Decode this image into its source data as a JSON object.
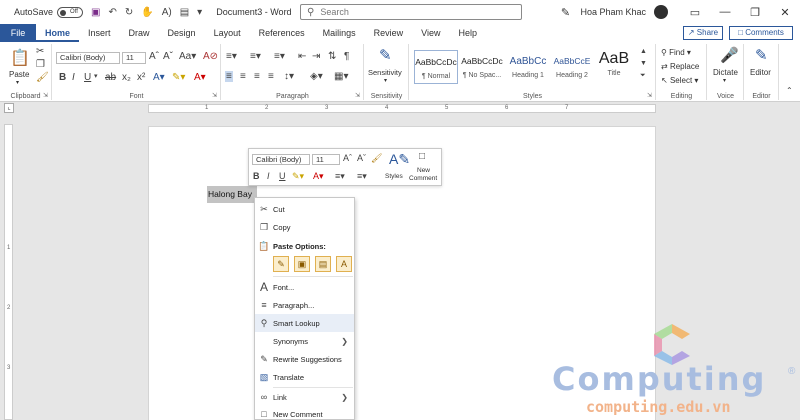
{
  "titlebar": {
    "autosave_label": "AutoSave",
    "autosave_state": "Off",
    "doc_title": "Document3 - Word",
    "search_placeholder": "Search",
    "user_name": "Hoa Pham Khac"
  },
  "tabs": [
    "File",
    "Home",
    "Insert",
    "Draw",
    "Design",
    "Layout",
    "References",
    "Mailings",
    "Review",
    "View",
    "Help"
  ],
  "active_tab": "Home",
  "share_label": "Share",
  "comments_label": "Comments",
  "ribbon": {
    "clipboard": {
      "paste_label": "Paste",
      "group_label": "Clipboard"
    },
    "font": {
      "font_name": "Calibri (Body)",
      "font_size": "11",
      "group_label": "Font"
    },
    "paragraph": {
      "group_label": "Paragraph"
    },
    "sensitivity": {
      "label": "Sensitivity",
      "group_label": "Sensitivity"
    },
    "styles": {
      "group_label": "Styles",
      "items": [
        {
          "sample": "AaBbCcDc",
          "name": "¶ Normal"
        },
        {
          "sample": "AaBbCcDc",
          "name": "¶ No Spac..."
        },
        {
          "sample": "AaBbCc",
          "name": "Heading 1"
        },
        {
          "sample": "AaBbCcE",
          "name": "Heading 2"
        },
        {
          "sample": "AaB",
          "name": "Title"
        }
      ]
    },
    "editing": {
      "find": "Find",
      "replace": "Replace",
      "select": "Select",
      "group_label": "Editing"
    },
    "voice": {
      "dictate": "Dictate",
      "group_label": "Voice"
    },
    "editor": {
      "label": "Editor",
      "group_label": "Editor"
    }
  },
  "ruler": {
    "marks": [
      "1",
      "2",
      "3",
      "4",
      "5",
      "6",
      "7"
    ],
    "vmarks": [
      "1",
      "2",
      "3"
    ]
  },
  "document": {
    "selected_text": "Halong Bay"
  },
  "mini_toolbar": {
    "font_name": "Calibri (Body)",
    "font_size": "11",
    "styles_label": "Styles",
    "new_comment_label1": "New",
    "new_comment_label2": "Comment"
  },
  "context_menu": {
    "cut": "Cut",
    "copy": "Copy",
    "paste_options": "Paste Options:",
    "font": "Font...",
    "paragraph": "Paragraph...",
    "smart_lookup": "Smart Lookup",
    "synonyms": "Synonyms",
    "rewrite": "Rewrite Suggestions",
    "translate": "Translate",
    "link": "Link",
    "new_comment": "New Comment"
  },
  "watermark": {
    "title": "Computing",
    "url": "computing.edu.vn",
    "reg": "®"
  },
  "colors": {
    "word_blue": "#2b579a",
    "accent_purple": "#7b2c8a",
    "hover": "#e8eef7"
  }
}
